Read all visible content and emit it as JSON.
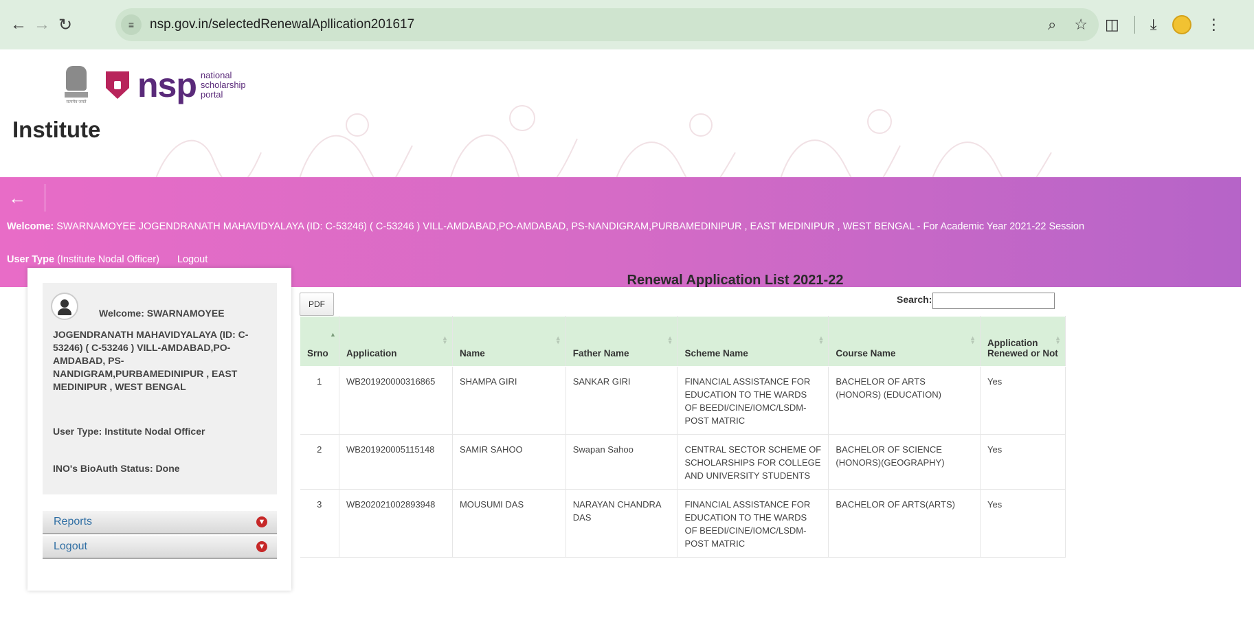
{
  "browser": {
    "url": "nsp.gov.in/selectedRenewalApllication201617"
  },
  "logo": {
    "emblem_caption": "सत्यमेव जयते",
    "nsp": "nsp",
    "sub1": "national",
    "sub2": "scholarship",
    "sub3": "portal"
  },
  "page": {
    "heading": "Institute"
  },
  "banner": {
    "welcome_label": "Welcome:",
    "welcome_text": "SWARNAMOYEE JOGENDRANATH MAHAVIDYALAYA (ID: C-53246) ( C-53246 ) VILL-AMDABAD,PO-AMDABAD, PS-NANDIGRAM,PURBAMEDINIPUR , EAST MEDINIPUR , WEST BENGAL - For Academic Year 2021-22 Session",
    "user_type_label": "User Type",
    "user_type_value": "(Institute Nodal Officer)",
    "logout": "Logout"
  },
  "sidebar": {
    "welcome": "Welcome: SWARNAMOYEE",
    "address": "JOGENDRANATH MAHAVIDYALAYA (ID: C-53246) ( C-53246 ) VILL-AMDABAD,PO-AMDABAD, PS-NANDIGRAM,PURBAMEDINIPUR , EAST MEDINIPUR , WEST BENGAL",
    "user_type": "User Type:   Institute Nodal Officer",
    "bio_status": "INO's BioAuth Status:   Done",
    "menu": [
      {
        "label": "Reports"
      },
      {
        "label": "Logout"
      }
    ]
  },
  "list": {
    "title": "Renewal Application List 2021-22",
    "pdf_label": "PDF",
    "search_label": "Search:",
    "search_value": "",
    "columns": [
      "Srno",
      "Application",
      "Name",
      "Father Name",
      "Scheme Name",
      "Course Name",
      "Application Renewed or Not"
    ],
    "rows": [
      {
        "srno": "1",
        "application": "WB201920000316865",
        "name": "SHAMPA GIRI",
        "father": "SANKAR GIRI",
        "scheme": "FINANCIAL ASSISTANCE FOR EDUCATION TO THE WARDS OF BEEDI/CINE/IOMC/LSDM- POST MATRIC",
        "course": "BACHELOR OF ARTS (HONORS) (EDUCATION)",
        "renewed": "Yes"
      },
      {
        "srno": "2",
        "application": "WB201920005115148",
        "name": "SAMIR SAHOO",
        "father": "Swapan Sahoo",
        "scheme": "CENTRAL SECTOR SCHEME OF SCHOLARSHIPS FOR COLLEGE AND UNIVERSITY STUDENTS",
        "course": "BACHELOR OF SCIENCE (HONORS)(GEOGRAPHY)",
        "renewed": "Yes"
      },
      {
        "srno": "3",
        "application": "WB202021002893948",
        "name": "MOUSUMI DAS",
        "father": "NARAYAN CHANDRA DAS",
        "scheme": "FINANCIAL ASSISTANCE FOR EDUCATION TO THE WARDS OF BEEDI/CINE/IOMC/LSDM- POST MATRIC",
        "course": "BACHELOR OF ARTS(ARTS)",
        "renewed": "Yes"
      }
    ]
  }
}
